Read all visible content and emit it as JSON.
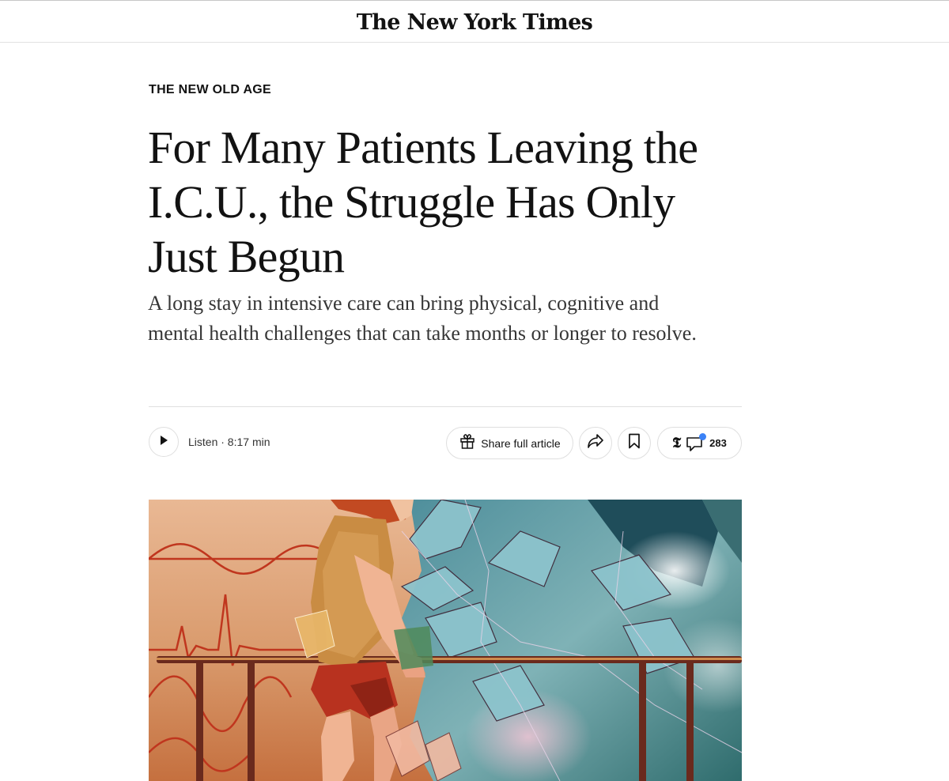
{
  "masthead": {
    "title": "The New York Times"
  },
  "article": {
    "kicker": "THE NEW OLD AGE",
    "headline": "For Many Patients Leaving the I.C.U., the Struggle Has Only Just Begun",
    "summary": "A long stay in intensive care can bring physical, cognitive and mental health challenges that can take months or longer to resolve."
  },
  "toolbar": {
    "listen_label": "Listen · 8:17 min",
    "share_full_label": "Share full article",
    "comments_count": "283"
  },
  "icons": {
    "play": "play-icon",
    "gift": "gift-icon",
    "share": "share-arrow-icon",
    "bookmark": "bookmark-icon",
    "t_logo": "nyt-t-logo-icon",
    "comment": "comment-bubble-icon"
  },
  "colors": {
    "notification_dot": "#3b82f6"
  }
}
